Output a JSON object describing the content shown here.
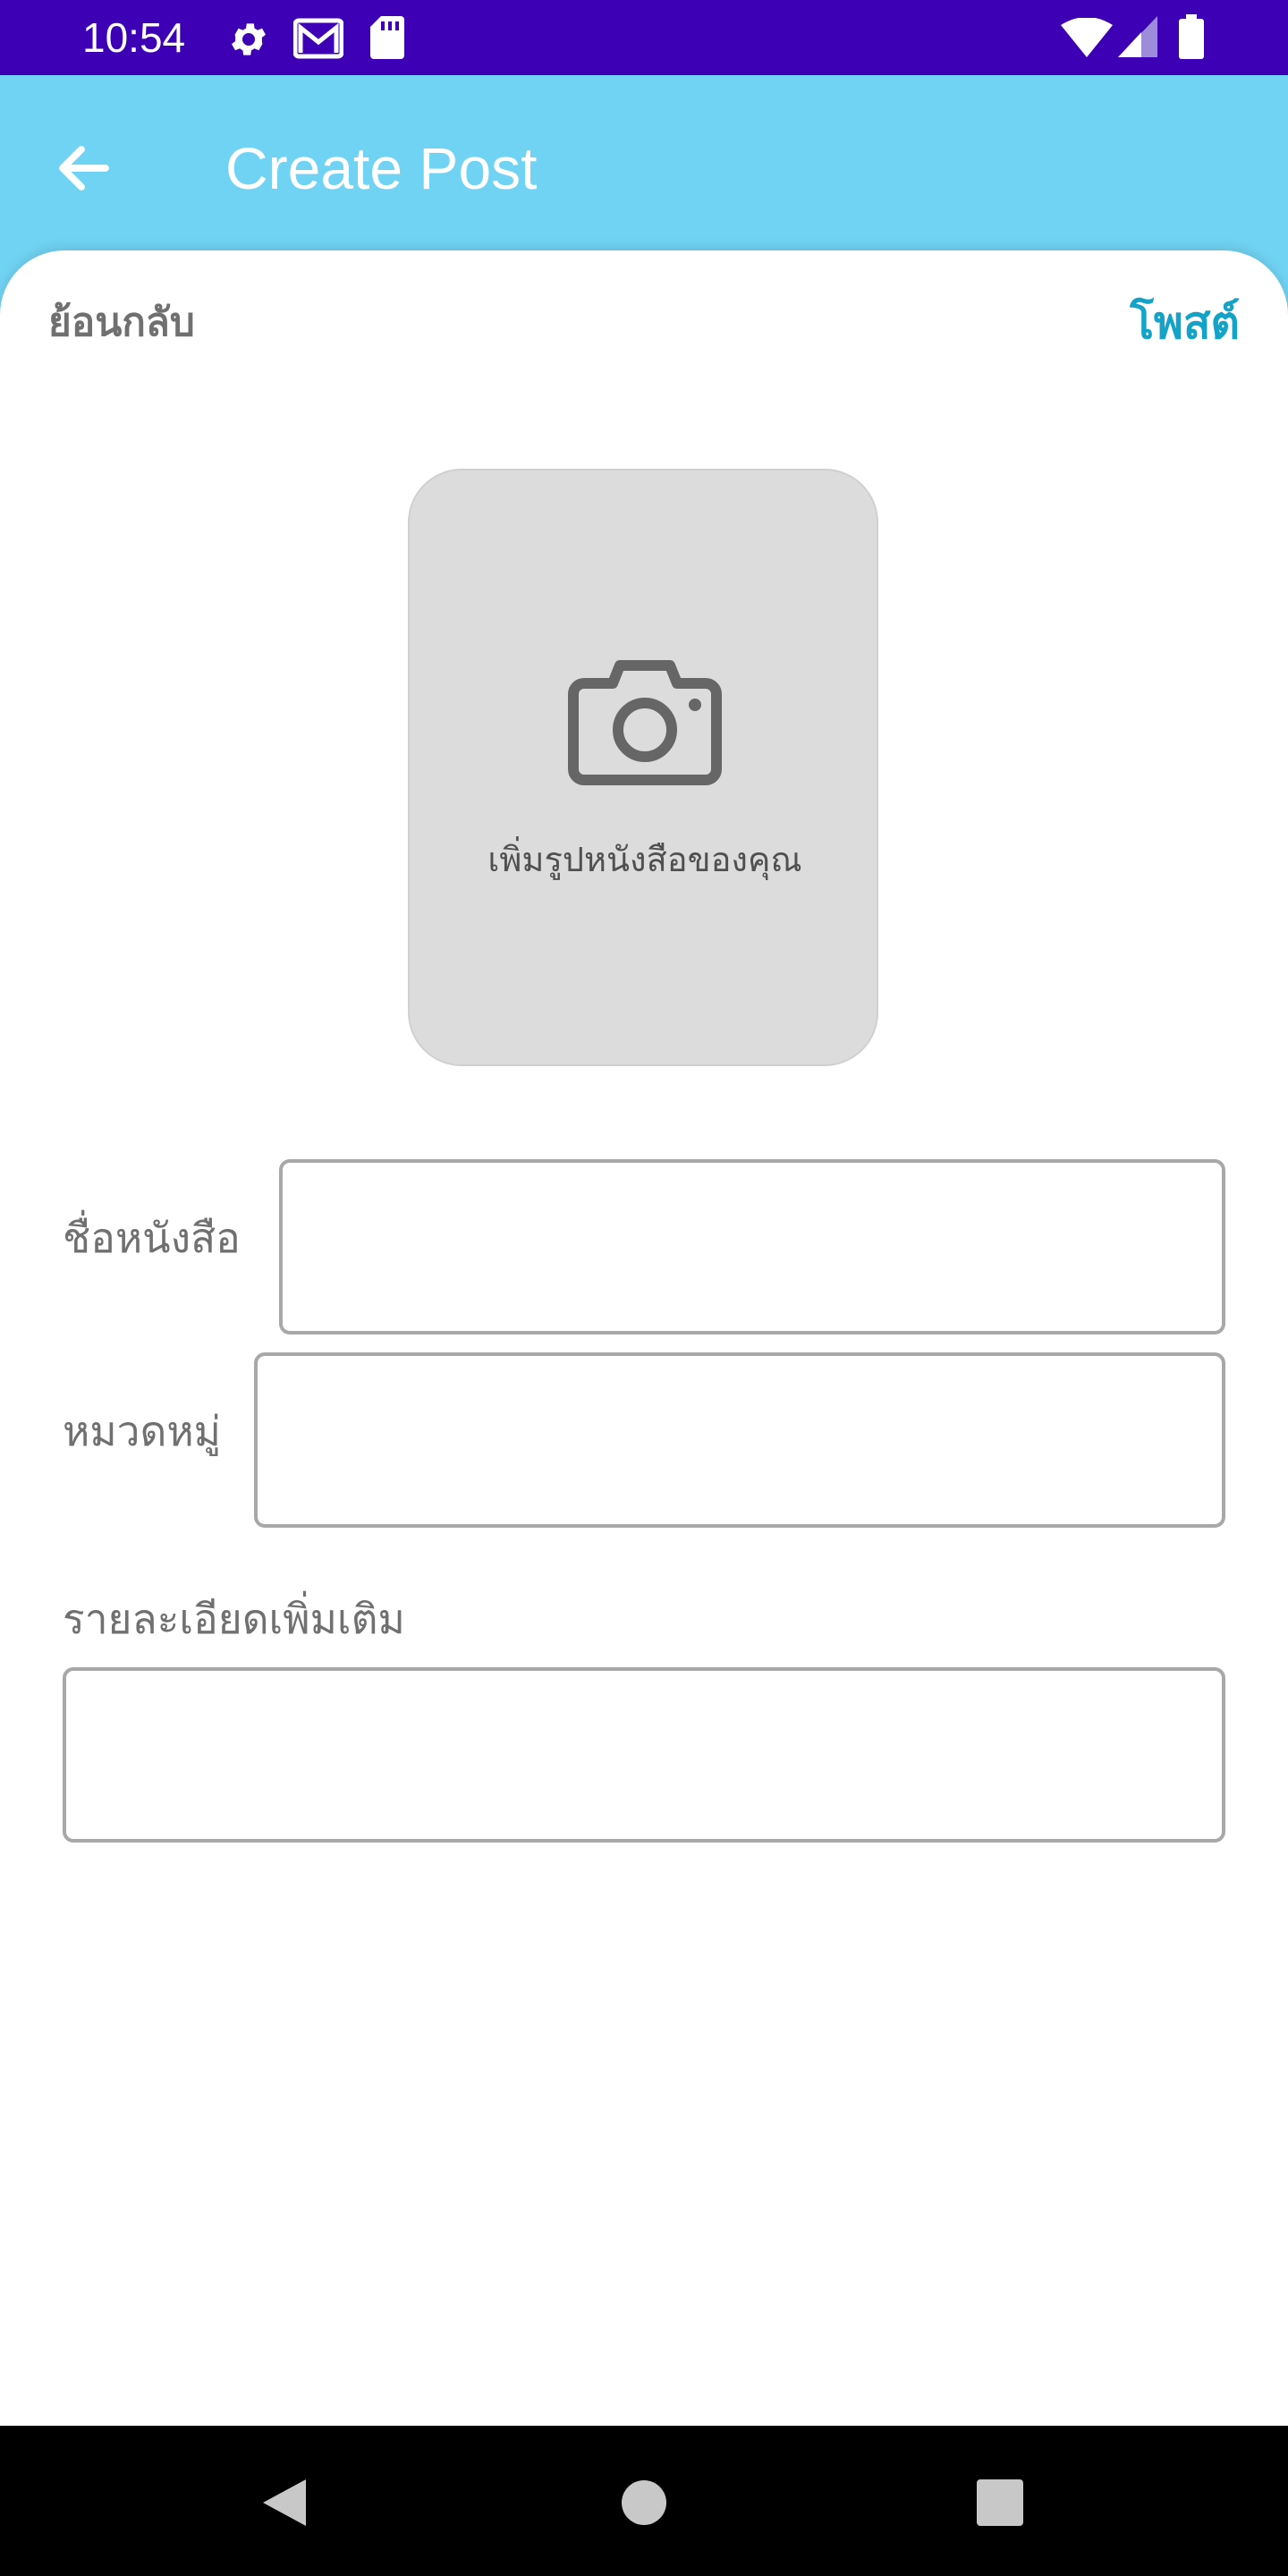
{
  "status_bar": {
    "time": "10:54",
    "background": "#3d00b4",
    "icons": [
      "gear-icon",
      "gmail-icon",
      "sd-card-icon",
      "wifi-icon",
      "signal-icon",
      "battery-icon"
    ]
  },
  "app_bar": {
    "title": "Create Post",
    "back_icon": "arrow-left-icon",
    "background": "#71d3f3"
  },
  "sheet": {
    "back_label": "ย้อนกลับ",
    "post_label": "โพสต์",
    "post_color": "#14a3c8"
  },
  "photo_picker": {
    "icon": "camera-icon",
    "label": "เพิ่มรูปหนังสือของคุณ"
  },
  "form": {
    "book_name_label": "ชื่อหนังสือ",
    "book_name_value": "",
    "category_label": "หมวดหมู่",
    "category_value": "",
    "details_label": "รายละเอียดเพิ่มเติม",
    "details_value": ""
  },
  "nav_bar": {
    "buttons": [
      "back-triangle-icon",
      "home-circle-icon",
      "recents-square-icon"
    ]
  }
}
